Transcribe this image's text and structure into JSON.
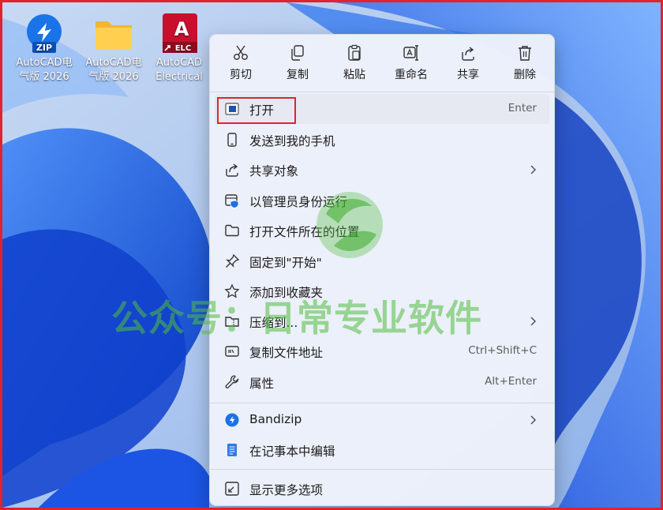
{
  "desktop": {
    "icons": [
      {
        "name": "zip-archive",
        "label_line1": "AutoCAD电",
        "label_line2": "气版 2026",
        "badge": "ZIP"
      },
      {
        "name": "folder",
        "label_line1": "AutoCAD电",
        "label_line2": "气版 2026"
      },
      {
        "name": "autocad-electrical",
        "label_line1": "AutoCAD",
        "label_line2": "Electrical",
        "badge_letter": "A",
        "badge_sub": "ELC"
      }
    ]
  },
  "context_menu": {
    "toolbar": [
      {
        "label": "剪切",
        "icon": "scissors-icon"
      },
      {
        "label": "复制",
        "icon": "copy-icon"
      },
      {
        "label": "粘贴",
        "icon": "paste-icon"
      },
      {
        "label": "重命名",
        "icon": "rename-icon"
      },
      {
        "label": "共享",
        "icon": "share-icon"
      },
      {
        "label": "删除",
        "icon": "trash-icon"
      }
    ],
    "items": [
      {
        "label": "打开",
        "shortcut": "Enter",
        "icon": "app-window-icon"
      },
      {
        "label": "发送到我的手机",
        "icon": "phone-icon"
      },
      {
        "label": "共享对象",
        "icon": "share-icon",
        "submenu": true
      },
      {
        "label": "以管理员身份运行",
        "icon": "shield-admin-icon"
      },
      {
        "label": "打开文件所在的位置",
        "icon": "folder-icon"
      },
      {
        "label": "固定到\"开始\"",
        "icon": "pin-icon"
      },
      {
        "label": "添加到收藏夹",
        "icon": "star-icon"
      },
      {
        "label": "压缩到...",
        "icon": "zip-icon",
        "submenu": true
      },
      {
        "label": "复制文件地址",
        "shortcut": "Ctrl+Shift+C",
        "icon": "path-icon"
      },
      {
        "label": "属性",
        "shortcut": "Alt+Enter",
        "icon": "wrench-icon"
      },
      {
        "label": "Bandizip",
        "icon": "bandizip-icon",
        "submenu": true
      },
      {
        "label": "在记事本中编辑",
        "icon": "notepad-icon"
      },
      {
        "label": "显示更多选项",
        "icon": "more-options-icon"
      }
    ]
  },
  "watermark": {
    "text": "公众号：日常专业软件"
  },
  "colors": {
    "highlight_border": "#e0242b",
    "watermark_green": "#50be3c",
    "wallpaper_blue": "#1f5fe0"
  }
}
